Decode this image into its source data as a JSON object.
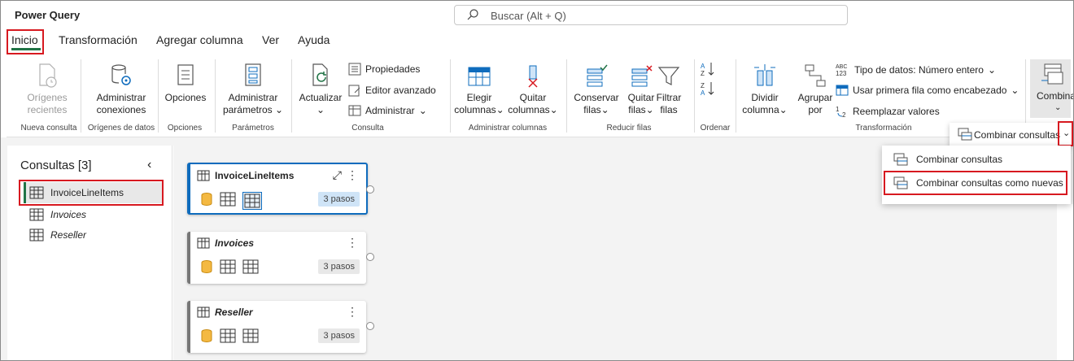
{
  "app": {
    "title": "Power Query"
  },
  "search": {
    "placeholder": "Buscar (Alt + Q)"
  },
  "tabs": [
    "Inicio",
    "Transformación",
    "Agregar columna",
    "Ver",
    "Ayuda"
  ],
  "ribbon": {
    "nueva_consulta": {
      "btn1": "Orígenes",
      "btn1b": "recientes",
      "label": "Nueva consulta"
    },
    "origenes": {
      "btn1": "Administrar",
      "btn1b": "conexiones",
      "label": "Orígenes de datos"
    },
    "opciones": {
      "btn1": "Opciones",
      "label": "Opciones"
    },
    "parametros": {
      "btn1": "Administrar",
      "btn1b": "parámetros",
      "label": "Parámetros"
    },
    "consulta": {
      "actualizar": "Actualizar",
      "propiedades": "Propiedades",
      "editor": "Editor avanzado",
      "administrar": "Administrar",
      "label": "Consulta"
    },
    "admin_columnas": {
      "elegir": "Elegir",
      "elegir_b": "columnas",
      "quitar": "Quitar",
      "quitar_b": "columnas",
      "label": "Administrar columnas"
    },
    "reducir": {
      "conservar": "Conservar",
      "conservar_b": "filas",
      "quitar": "Quitar",
      "quitar_b": "filas",
      "filtrar": "Filtrar",
      "filtrar_b": "filas",
      "label": "Reducir filas"
    },
    "ordenar": {
      "label": "Ordenar"
    },
    "transformacion": {
      "dividir": "Dividir",
      "dividir_b": "columna",
      "agrupar": "Agrupar",
      "agrupar_b": "por",
      "tipo": "Tipo de datos: Número entero",
      "primera": "Usar primera fila como encabezado",
      "reemplazar": "Reemplazar valores",
      "label": "Transformación"
    },
    "combinar": {
      "label": "Combinar"
    }
  },
  "queries": {
    "header": "Consultas [3]",
    "items": [
      "InvoiceLineItems",
      "Invoices",
      "Reseller"
    ]
  },
  "cards": [
    {
      "name": "InvoiceLineItems",
      "steps": "3 pasos"
    },
    {
      "name": "Invoices",
      "steps": "3 pasos"
    },
    {
      "name": "Reseller",
      "steps": "3 pasos"
    }
  ],
  "combine_menu": {
    "top": "Combinar consultas",
    "item1": "Combinar consultas",
    "item2": "Combinar consultas como nuevas"
  },
  "colors": {
    "accent": "#217346",
    "highlight": "#d71920",
    "selected_card": "#0f6cbd"
  }
}
